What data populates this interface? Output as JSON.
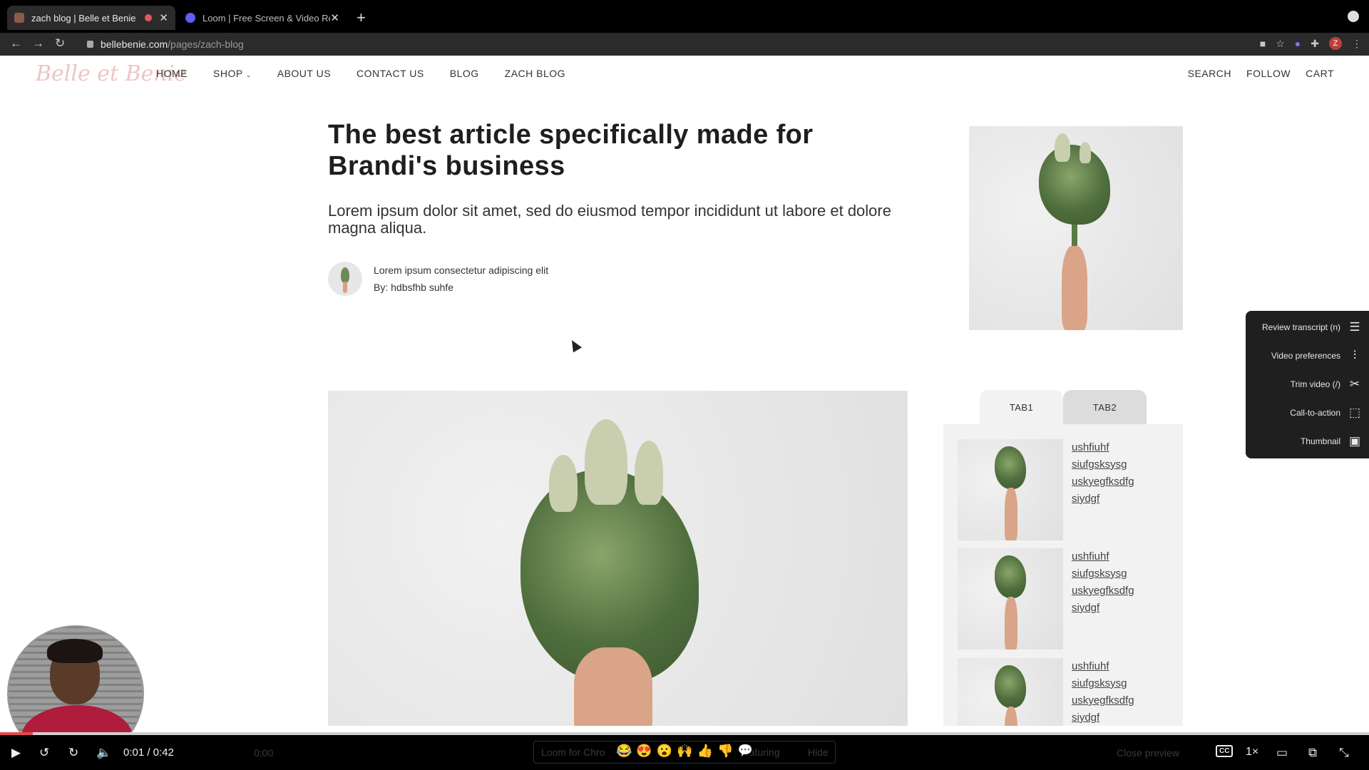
{
  "browser": {
    "tabs": [
      {
        "title": "zach blog | Belle et Benie",
        "favicon_color": "#8a5a4a",
        "recording": true,
        "active": true
      },
      {
        "title": "Loom | Free Screen & Video Re",
        "favicon_color": "#625df5",
        "active": false
      }
    ],
    "new_tab": "+",
    "url_host": "bellebenie.com",
    "url_path": "/pages/zach-blog",
    "profile_initial": "Z"
  },
  "site": {
    "logo_text": "Belle et Benie",
    "nav": [
      "HOME",
      "SHOP",
      "ABOUT US",
      "CONTACT US",
      "BLOG",
      "ZACH BLOG"
    ],
    "nav_right": [
      "SEARCH",
      "FOLLOW",
      "CART"
    ]
  },
  "article": {
    "headline": "The best article specifically made for Brandi's business",
    "lede": "Lorem ipsum dolor sit amet, sed do eiusmod tempor incididunt ut labore et dolore magna aliqua.",
    "author_caption": "Lorem ipsum consectetur adipiscing elit",
    "author_byline": "By: hdbsfhb suhfe"
  },
  "tabs": {
    "labels": [
      "TAB1",
      "TAB2"
    ],
    "active": "TAB1",
    "items": [
      {
        "links": [
          "ushfiuhf",
          "siufgsksysg",
          "uskyegfksdfg",
          "siydgf"
        ]
      },
      {
        "links": [
          "ushfiuhf",
          "siufgsksysg",
          "uskyegfksdfg",
          "siydgf"
        ]
      },
      {
        "links": [
          "ushfiuhf",
          "siufgsksysg",
          "uskyegfksdfg",
          "siydgf"
        ]
      }
    ]
  },
  "loom_menu": {
    "items": [
      {
        "label": "Review transcript (n)",
        "icon": "transcript-icon"
      },
      {
        "label": "Video preferences",
        "icon": "sliders-icon"
      },
      {
        "label": "Trim video (/)",
        "icon": "scissors-icon"
      },
      {
        "label": "Call-to-action",
        "icon": "cursor-click-icon"
      },
      {
        "label": "Thumbnail",
        "icon": "image-icon"
      }
    ]
  },
  "player": {
    "current_time": "0:01",
    "duration": "0:42",
    "time_display": "0:01 / 0:42",
    "progress": 0.024,
    "speed": "1×",
    "cc": "CC",
    "reactions": [
      "😂",
      "😍",
      "😮",
      "🙌",
      "👍",
      "👎"
    ],
    "ghost_time": "0:00",
    "ghost_left": "Loom for Chro",
    "ghost_mid": "featuring",
    "ghost_hide": "Hide",
    "ghost_right": "Close preview"
  }
}
